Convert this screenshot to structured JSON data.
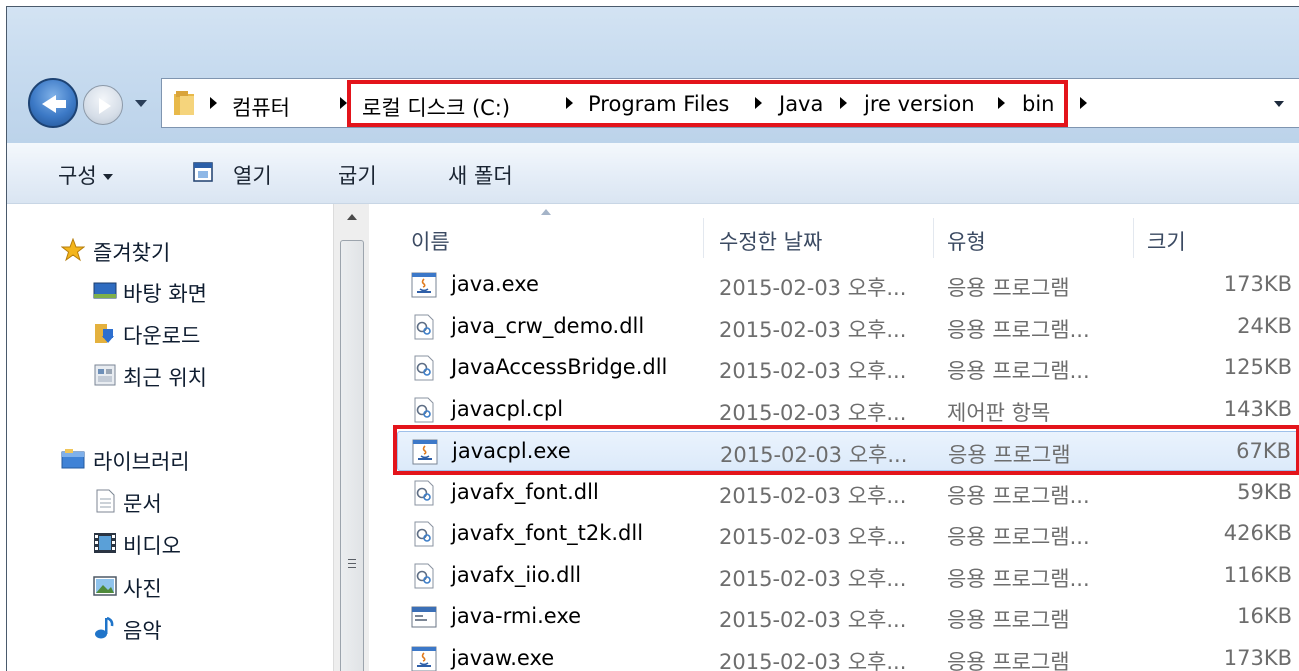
{
  "address": {
    "crumbs": [
      "컴퓨터",
      "로컬 디스크 (C:)",
      "Program Files",
      "Java",
      "jre version",
      "bin"
    ]
  },
  "toolbar": {
    "organize": "구성",
    "open": "열기",
    "burn": "굽기",
    "new_folder": "새 폴더"
  },
  "sidebar": {
    "favorites": "즐겨찾기",
    "desktop": "바탕 화면",
    "downloads": "다운로드",
    "recent": "최근 위치",
    "libraries": "라이브러리",
    "documents": "문서",
    "videos": "비디오",
    "pictures": "사진",
    "music": "음악"
  },
  "columns": {
    "name": "이름",
    "date": "수정한 날짜",
    "type": "유형",
    "size": "크기"
  },
  "files": [
    {
      "name": "java.exe",
      "date": "2015-02-03 오후...",
      "type": "응용 프로그램",
      "size": "173KB",
      "icon": "java-app-icon"
    },
    {
      "name": "java_crw_demo.dll",
      "date": "2015-02-03 오후...",
      "type": "응용 프로그램...",
      "size": "24KB",
      "icon": "dll-icon"
    },
    {
      "name": "JavaAccessBridge.dll",
      "date": "2015-02-03 오후...",
      "type": "응용 프로그램...",
      "size": "125KB",
      "icon": "dll-icon"
    },
    {
      "name": "javacpl.cpl",
      "date": "2015-02-03 오후...",
      "type": "제어판 항목",
      "size": "143KB",
      "icon": "dll-icon"
    },
    {
      "name": "javacpl.exe",
      "date": "2015-02-03 오후...",
      "type": "응용 프로그램",
      "size": "67KB",
      "icon": "java-app-icon"
    },
    {
      "name": "javafx_font.dll",
      "date": "2015-02-03 오후...",
      "type": "응용 프로그램...",
      "size": "59KB",
      "icon": "dll-icon"
    },
    {
      "name": "javafx_font_t2k.dll",
      "date": "2015-02-03 오후...",
      "type": "응용 프로그램...",
      "size": "426KB",
      "icon": "dll-icon"
    },
    {
      "name": "javafx_iio.dll",
      "date": "2015-02-03 오후...",
      "type": "응용 프로그램...",
      "size": "116KB",
      "icon": "dll-icon"
    },
    {
      "name": "java-rmi.exe",
      "date": "2015-02-03 오후...",
      "type": "응용 프로그램",
      "size": "16KB",
      "icon": "console-app-icon"
    },
    {
      "name": "javaw.exe",
      "date": "2015-02-03 오후...",
      "type": "응용 프로그램",
      "size": "173KB",
      "icon": "java-app-icon"
    }
  ],
  "selected_file": "javacpl.exe",
  "colors": {
    "highlight_box": "#e3141b",
    "selection": "#dceafa"
  }
}
